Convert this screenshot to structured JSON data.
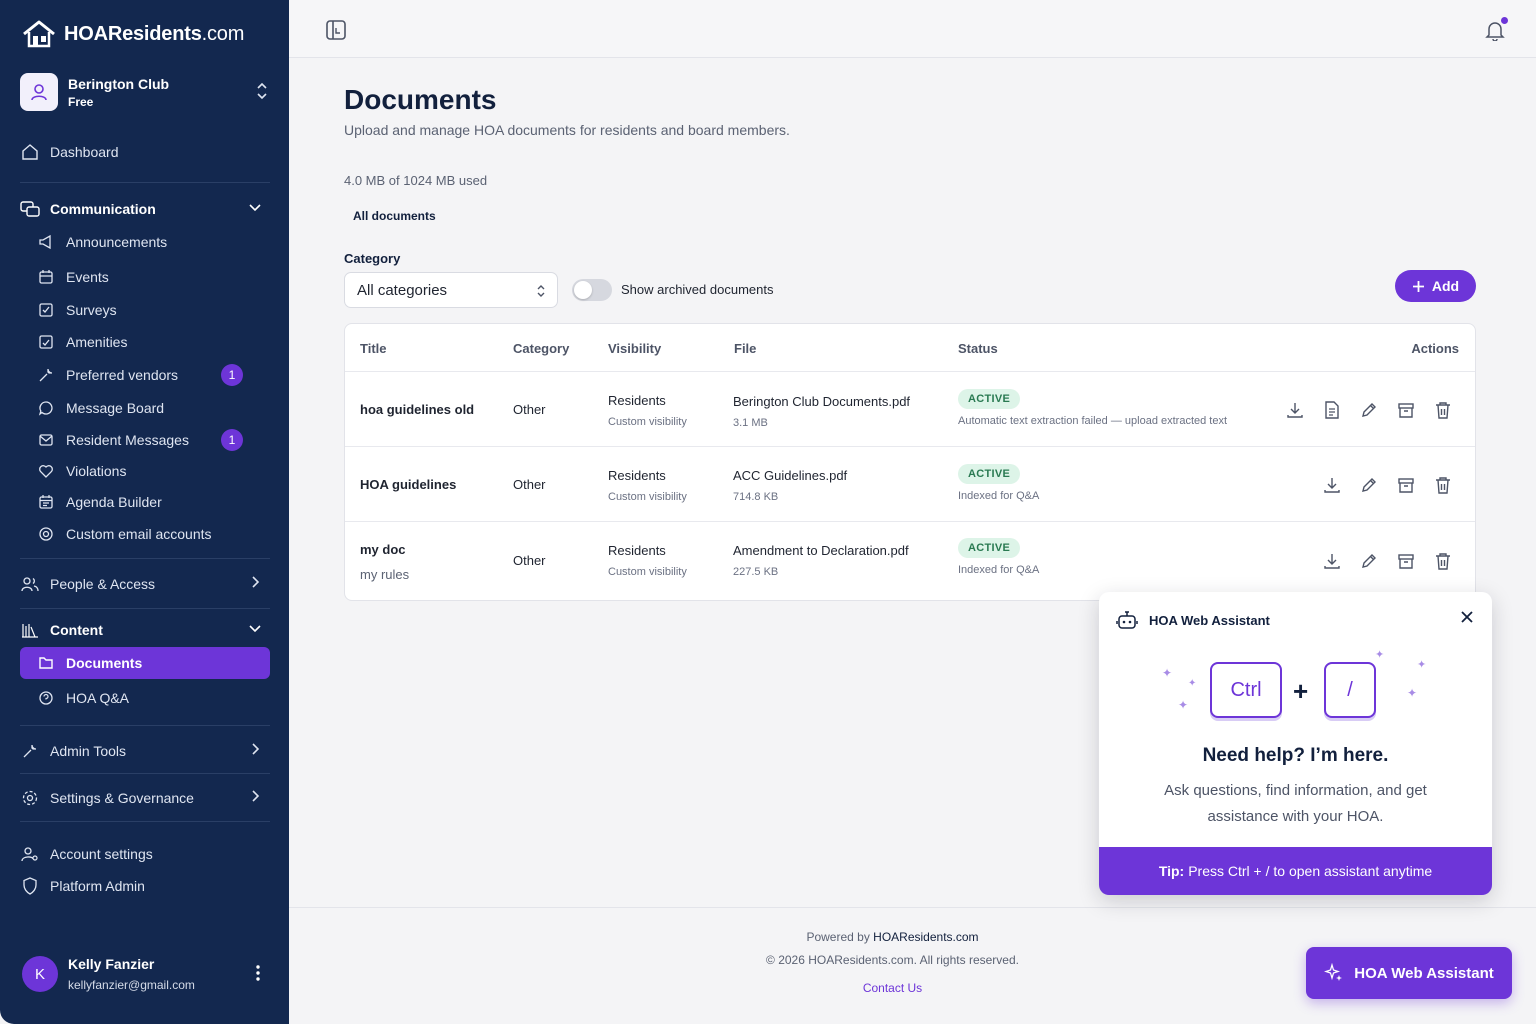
{
  "brand": {
    "name_bold": "HOAResidents",
    "name_suffix": ".com"
  },
  "org": {
    "name": "Berington Club",
    "plan": "Free"
  },
  "sidebar": {
    "dashboard": "Dashboard",
    "communication": {
      "label": "Communication",
      "items": [
        {
          "label": "Announcements",
          "icon": "megaphone-icon"
        },
        {
          "label": "Events",
          "icon": "calendar-icon"
        },
        {
          "label": "Surveys",
          "icon": "survey-icon"
        },
        {
          "label": "Amenities",
          "icon": "amenities-icon"
        },
        {
          "label": "Preferred vendors",
          "icon": "wrench-icon",
          "badge": "1"
        },
        {
          "label": "Message Board",
          "icon": "chat-bubble-icon"
        },
        {
          "label": "Resident Messages",
          "icon": "mail-icon",
          "badge": "1"
        },
        {
          "label": "Violations",
          "icon": "heart-icon"
        },
        {
          "label": "Agenda Builder",
          "icon": "calendar-list-icon"
        },
        {
          "label": "Custom email accounts",
          "icon": "at-sign-icon"
        }
      ]
    },
    "people_access": "People & Access",
    "content": {
      "label": "Content",
      "items": [
        {
          "label": "Documents",
          "icon": "folder-icon"
        },
        {
          "label": "HOA Q&A",
          "icon": "question-circle-icon"
        }
      ]
    },
    "admin_tools": "Admin Tools",
    "settings_governance": "Settings & Governance",
    "account_settings": "Account settings",
    "platform_admin": "Platform Admin"
  },
  "user": {
    "initial": "K",
    "name": "Kelly Fanzier",
    "email": "kellyfanzier@gmail.com"
  },
  "page": {
    "title": "Documents",
    "subtitle": "Upload and manage HOA documents for residents and board members.",
    "usage": "4.0 MB of 1024 MB used",
    "tab": "All documents",
    "category_label": "Category",
    "category_value": "All categories",
    "show_archived": "Show archived documents",
    "add_label": "Add"
  },
  "table": {
    "headers": {
      "title": "Title",
      "category": "Category",
      "visibility": "Visibility",
      "file": "File",
      "status": "Status",
      "actions": "Actions"
    },
    "rows": [
      {
        "title": "hoa guidelines old",
        "subtitle": "",
        "category": "Other",
        "visibility": "Residents",
        "visibility_note": "Custom visibility",
        "file": "Berington Club Documents.pdf",
        "size": "3.1 MB",
        "status": "ACTIVE",
        "status_note": "Automatic text extraction failed — upload extracted text"
      },
      {
        "title": "HOA guidelines",
        "subtitle": "",
        "category": "Other",
        "visibility": "Residents",
        "visibility_note": "Custom visibility",
        "file": "ACC Guidelines.pdf",
        "size": "714.8 KB",
        "status": "ACTIVE",
        "status_note": "Indexed for Q&A"
      },
      {
        "title": "my doc",
        "subtitle": "my rules",
        "category": "Other",
        "visibility": "Residents",
        "visibility_note": "Custom visibility",
        "file": "Amendment to Declaration.pdf",
        "size": "227.5 KB",
        "status": "ACTIVE",
        "status_note": "Indexed for Q&A"
      }
    ]
  },
  "footer": {
    "powered_prefix": "Powered by",
    "powered_brand": "HOAResidents.com",
    "copyright": "© 2026 HOAResidents.com. All rights reserved.",
    "contact": "Contact Us"
  },
  "assistant": {
    "header": "HOA Web Assistant",
    "key1": "Ctrl",
    "plus": "+",
    "key2": "/",
    "title": "Need help? I’m here.",
    "desc": "Ask questions, find information, and get assistance with your HOA.",
    "tip_label": "Tip:",
    "tip_text": "Press Ctrl + / to open assistant anytime",
    "button": "HOA Web Assistant"
  },
  "colors": {
    "sidebar": "#13284f",
    "accent": "#6d35d8",
    "status_bg": "#ddf4e8",
    "status_text": "#2a7a52"
  }
}
